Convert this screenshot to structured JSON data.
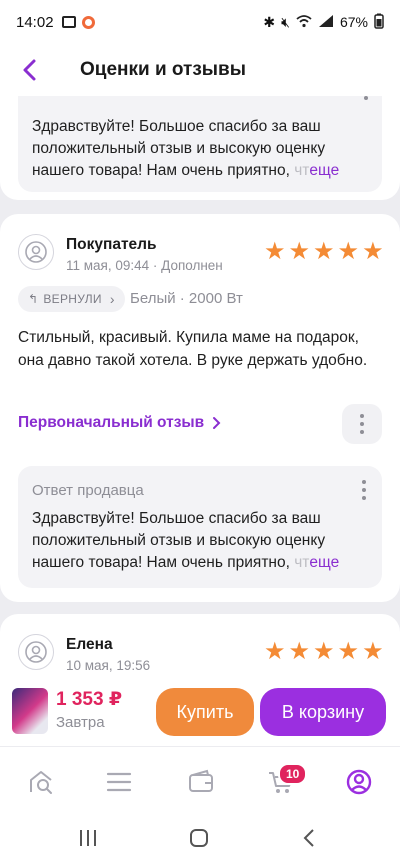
{
  "status": {
    "time": "14:02",
    "battery": "67%"
  },
  "header": {
    "title": "Оценки и отзывы"
  },
  "top_reply": {
    "text": "Здравствуйте! Большое спасибо за ваш положительный отзыв и высокую оценку нашего товара! Нам очень приятно,",
    "fade": "чт",
    "more": "еще"
  },
  "review1": {
    "author": "Покупатель",
    "date": "11 мая, 09:44 · Дополнен",
    "rating": 5,
    "returned_chip": "ВЕРНУЛИ",
    "variant": "Белый · 2000 Вт",
    "text": "Стильный, красивый. Купила маме на подарок, она давно такой хотела. В руке держать удобно.",
    "original_link": "Первоначальный отзыв",
    "seller_reply": {
      "label": "Ответ продавца",
      "text": "Здравствуйте! Большое спасибо за ваш положительный отзыв и высокую оценку нашего товара! Нам очень приятно,",
      "fade": "чт",
      "more": "еще"
    }
  },
  "review2": {
    "author": "Елена",
    "date": "10 мая, 19:56",
    "rating": 5
  },
  "buybar": {
    "price": "1 353 ₽",
    "delivery": "Завтра",
    "buy_label": "Купить",
    "cart_label": "В корзину"
  },
  "bottom_nav": {
    "cart_badge": "10"
  },
  "colors": {
    "accent": "#9b2fe0",
    "link": "#8a2ed0",
    "star": "#f48b35",
    "price": "#e0245e",
    "buy": "#f08a3c"
  }
}
